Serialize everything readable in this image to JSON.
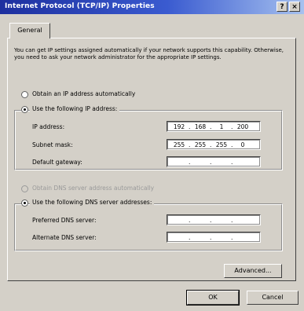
{
  "window": {
    "title": "Internet Protocol (TCP/IP) Properties",
    "help_glyph": "?",
    "close_glyph": "×"
  },
  "tab": {
    "label": "General"
  },
  "intro_text": "You can get IP settings assigned automatically if your network supports this capability. Otherwise, you need to ask your network administrator for the appropriate IP settings.",
  "ip_section": {
    "auto_label": "Obtain an IP address automatically",
    "manual_label": "Use the following IP address:",
    "selected": "manual",
    "fields": [
      {
        "label": "IP address:",
        "octets": [
          "192",
          "168",
          "1",
          "200"
        ]
      },
      {
        "label": "Subnet mask:",
        "octets": [
          "255",
          "255",
          "255",
          "0"
        ]
      },
      {
        "label": "Default gateway:",
        "octets": [
          "",
          "",
          "",
          ""
        ]
      }
    ]
  },
  "dns_section": {
    "auto_label": "Obtain DNS server address automatically",
    "manual_label": "Use the following DNS server addresses:",
    "selected": "manual",
    "fields": [
      {
        "label": "Preferred DNS server:",
        "octets": [
          "",
          "",
          "",
          ""
        ]
      },
      {
        "label": "Alternate DNS server:",
        "octets": [
          "",
          "",
          "",
          ""
        ]
      }
    ]
  },
  "buttons": {
    "advanced": "Advanced...",
    "ok": "OK",
    "cancel": "Cancel"
  }
}
